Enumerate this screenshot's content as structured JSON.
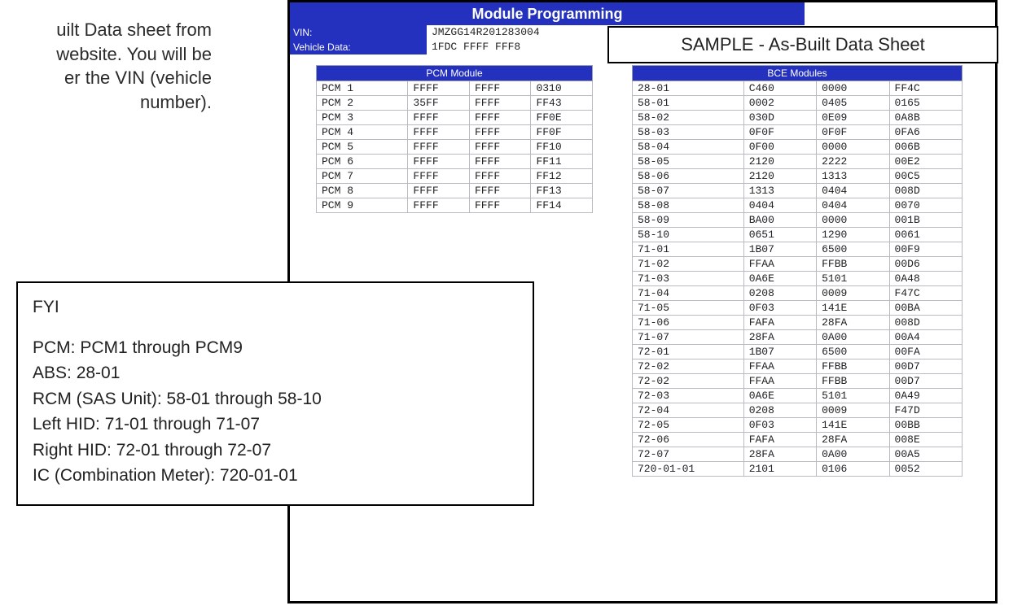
{
  "left_text": {
    "line1": "uilt Data sheet from",
    "line2": "website. You will be",
    "line3": "er the VIN (vehicle",
    "line4": "number)."
  },
  "sample_label": "SAMPLE - As-Built Data Sheet",
  "title": "Module Programming",
  "header": {
    "vin_label": "VIN:",
    "vin_value": "JMZGG14R201283004",
    "vehicle_data_label": "Vehicle Data:",
    "vehicle_data_value": "1FDC  FFFF  FFF8"
  },
  "pcm": {
    "title": "PCM Module",
    "rows": [
      {
        "id": "PCM 1",
        "a": "FFFF",
        "b": "FFFF",
        "c": "0310"
      },
      {
        "id": "PCM 2",
        "a": "35FF",
        "b": "FFFF",
        "c": "FF43"
      },
      {
        "id": "PCM 3",
        "a": "FFFF",
        "b": "FFFF",
        "c": "FF0E"
      },
      {
        "id": "PCM 4",
        "a": "FFFF",
        "b": "FFFF",
        "c": "FF0F"
      },
      {
        "id": "PCM 5",
        "a": "FFFF",
        "b": "FFFF",
        "c": "FF10"
      },
      {
        "id": "PCM 6",
        "a": "FFFF",
        "b": "FFFF",
        "c": "FF11"
      },
      {
        "id": "PCM 7",
        "a": "FFFF",
        "b": "FFFF",
        "c": "FF12"
      },
      {
        "id": "PCM 8",
        "a": "FFFF",
        "b": "FFFF",
        "c": "FF13"
      },
      {
        "id": "PCM 9",
        "a": "FFFF",
        "b": "FFFF",
        "c": "FF14"
      }
    ]
  },
  "bce": {
    "title": "BCE Modules",
    "rows": [
      {
        "id": "28-01",
        "a": "C460",
        "b": "0000",
        "c": "FF4C"
      },
      {
        "id": "58-01",
        "a": "0002",
        "b": "0405",
        "c": "0165"
      },
      {
        "id": "58-02",
        "a": "030D",
        "b": "0E09",
        "c": "0A8B"
      },
      {
        "id": "58-03",
        "a": "0F0F",
        "b": "0F0F",
        "c": "0FA6"
      },
      {
        "id": "58-04",
        "a": "0F00",
        "b": "0000",
        "c": "006B"
      },
      {
        "id": "58-05",
        "a": "2120",
        "b": "2222",
        "c": "00E2"
      },
      {
        "id": "58-06",
        "a": "2120",
        "b": "1313",
        "c": "00C5"
      },
      {
        "id": "58-07",
        "a": "1313",
        "b": "0404",
        "c": "008D"
      },
      {
        "id": "58-08",
        "a": "0404",
        "b": "0404",
        "c": "0070"
      },
      {
        "id": "58-09",
        "a": "BA00",
        "b": "0000",
        "c": "001B"
      },
      {
        "id": "58-10",
        "a": "0651",
        "b": "1290",
        "c": "0061"
      },
      {
        "id": "71-01",
        "a": "1B07",
        "b": "6500",
        "c": "00F9"
      },
      {
        "id": "71-02",
        "a": "FFAA",
        "b": "FFBB",
        "c": "00D6"
      },
      {
        "id": "71-03",
        "a": "0A6E",
        "b": "5101",
        "c": "0A48"
      },
      {
        "id": "71-04",
        "a": "0208",
        "b": "0009",
        "c": "F47C"
      },
      {
        "id": "71-05",
        "a": "0F03",
        "b": "141E",
        "c": "00BA"
      },
      {
        "id": "71-06",
        "a": "FAFA",
        "b": "28FA",
        "c": "008D"
      },
      {
        "id": "71-07",
        "a": "28FA",
        "b": "0A00",
        "c": "00A4"
      },
      {
        "id": "72-01",
        "a": "1B07",
        "b": "6500",
        "c": "00FA"
      },
      {
        "id": "72-02",
        "a": "FFAA",
        "b": "FFBB",
        "c": "00D7"
      },
      {
        "id": "72-02",
        "a": "FFAA",
        "b": "FFBB",
        "c": "00D7"
      },
      {
        "id": "72-03",
        "a": "0A6E",
        "b": "5101",
        "c": "0A49"
      },
      {
        "id": "72-04",
        "a": "0208",
        "b": "0009",
        "c": "F47D"
      },
      {
        "id": "72-05",
        "a": "0F03",
        "b": "141E",
        "c": "00BB"
      },
      {
        "id": "72-06",
        "a": "FAFA",
        "b": "28FA",
        "c": "008E"
      },
      {
        "id": "72-07",
        "a": "28FA",
        "b": "0A00",
        "c": "00A5"
      },
      {
        "id": "720-01-01",
        "a": "2101",
        "b": "0106",
        "c": "0052"
      }
    ]
  },
  "fyi": {
    "title": "FYI",
    "lines": [
      "PCM: PCM1 through PCM9",
      "ABS: 28-01",
      "RCM (SAS Unit): 58-01 through 58-10",
      "Left HID: 71-01 through 71-07",
      "Right HID: 72-01 through 72-07",
      "IC (Combination Meter): 720-01-01"
    ]
  }
}
